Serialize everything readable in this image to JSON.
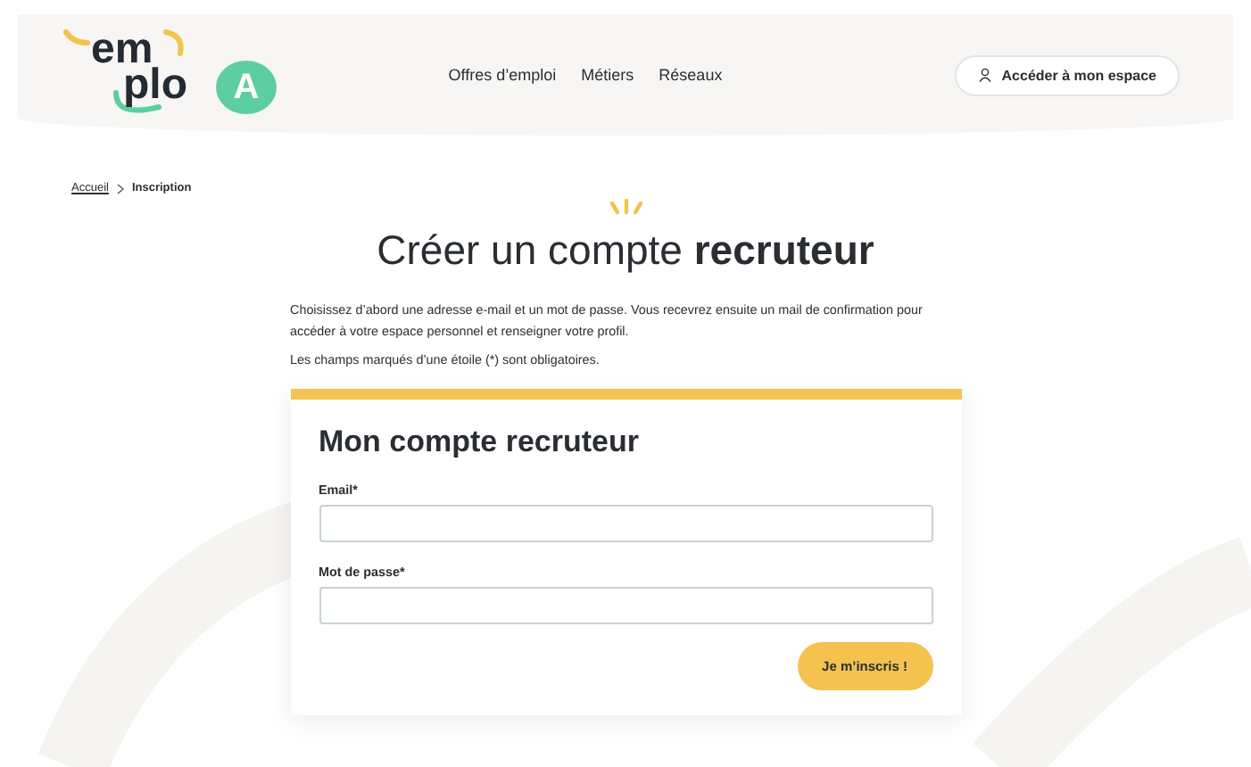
{
  "logo": {
    "part_1": "em",
    "part_2": "plo",
    "part_3": "A"
  },
  "nav": [
    "Offres d’emploi",
    "Métiers",
    "Réseaux"
  ],
  "account_button": "Accéder à mon espace",
  "breadcrumb": [
    {
      "label": "Accueil",
      "selected": false
    },
    {
      "label": "Inscription",
      "selected": true
    }
  ],
  "title": "Créer un compte **recruteur**",
  "intro": "Choisissez d’abord une adresse e-mail et un mot de passe. Vous recevrez ensuite un mail de confirmation pour accéder à votre espace personnel et renseigner votre profil.",
  "required_note": "Les champs marqués d’une étoile (*) sont obligatoires.",
  "form": {
    "title": "Mon compte recruteur",
    "fields": [
      {
        "label": "Email*"
      },
      {
        "label": "Mot de passe*"
      }
    ],
    "submit": "Je m’inscris !"
  }
}
